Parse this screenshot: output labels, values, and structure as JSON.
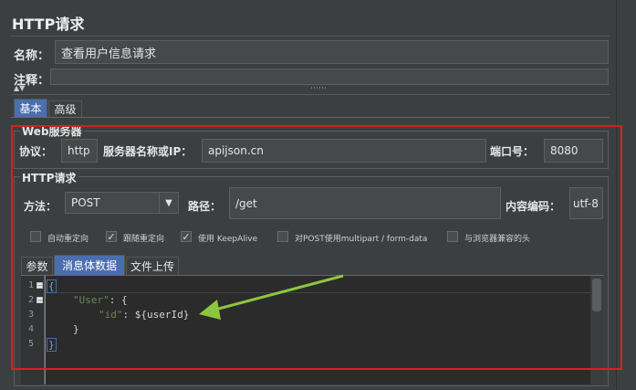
{
  "window": {
    "title": "HTTP请求"
  },
  "name_row": {
    "label": "名称：",
    "value": "查看用户信息请求"
  },
  "comment_row": {
    "label": "注释：",
    "value": ""
  },
  "collapse_arrows": "▲▼",
  "splitter_grip": "⋯⋯",
  "tabs": {
    "basic": "基本",
    "advanced": "高级"
  },
  "web_server": {
    "legend": "Web服务器",
    "protocol_label": "协议：",
    "protocol_value": "http",
    "server_label": "服务器名称或IP：",
    "server_value": "apijson.cn",
    "port_label": "端口号：",
    "port_value": "8080"
  },
  "http_request": {
    "legend": "HTTP请求",
    "method_label": "方法：",
    "method_value": "POST",
    "path_label": "路径：",
    "path_value": "/get",
    "encoding_label": "内容编码：",
    "encoding_value": "utf-8"
  },
  "options": [
    {
      "label": "自动重定向",
      "checked": false
    },
    {
      "label": "跟随重定向",
      "checked": true
    },
    {
      "label": "使用 KeepAlive",
      "checked": true
    },
    {
      "label": "对POST使用multipart / form-data",
      "checked": false
    },
    {
      "label": "与浏览器兼容的头",
      "checked": false
    }
  ],
  "body_tabs": {
    "params": "参数",
    "body": "消息体数据",
    "upload": "文件上传"
  },
  "editor": {
    "line_numbers": [
      "1",
      "2",
      "3",
      "4",
      "5"
    ],
    "lines": {
      "l1": "{",
      "l2_key": "\"User\"",
      "l2_rest": ": {",
      "l3_key": "\"id\"",
      "l3_rest": ": ${userId}",
      "l4": "}",
      "l5": "}"
    }
  },
  "colors": {
    "highlight_box": "#d82020",
    "annotation_arrow": "#8cc63f",
    "active_tab": "#4b6eaf"
  }
}
